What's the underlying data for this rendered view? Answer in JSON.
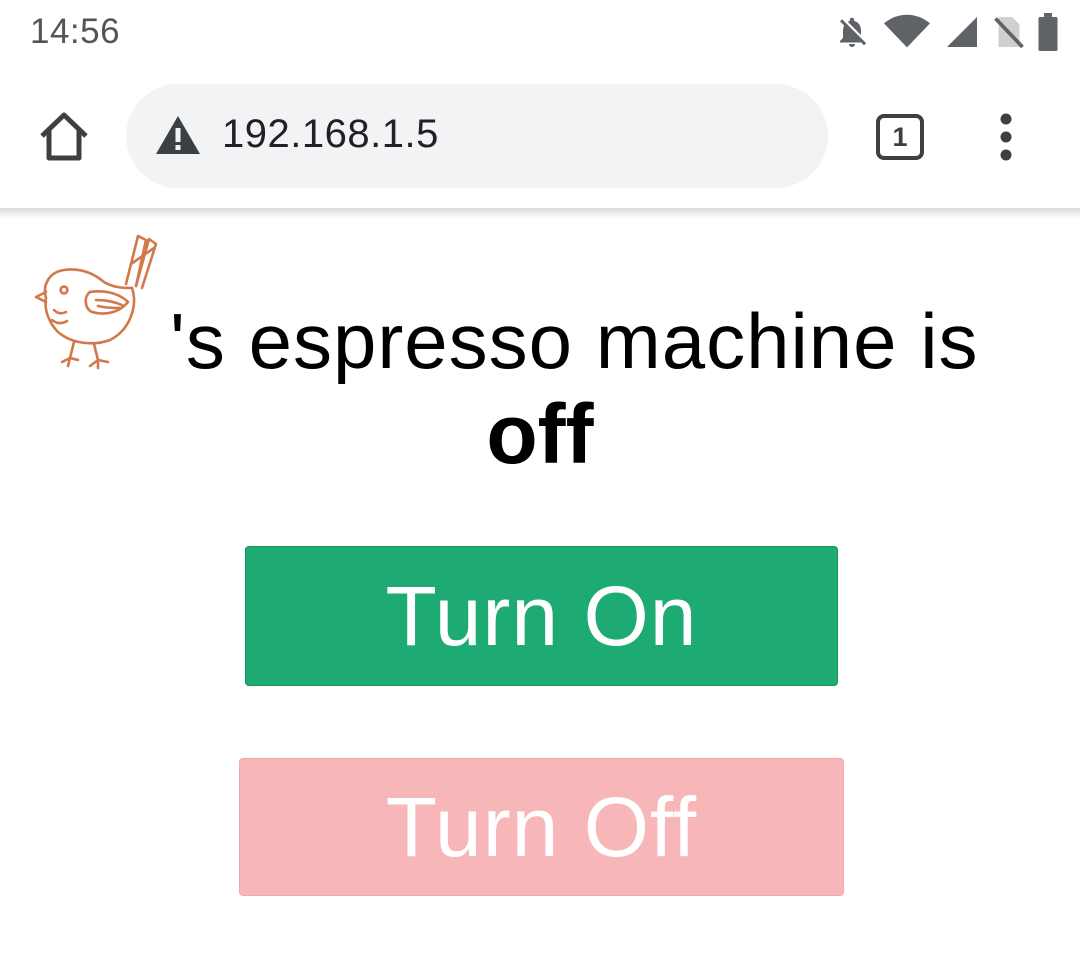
{
  "status_bar": {
    "time": "14:56",
    "icons": [
      "notifications-off-icon",
      "wifi-icon",
      "cell-signal-icon",
      "no-sim-icon",
      "battery-icon"
    ]
  },
  "browser": {
    "url": "192.168.1.5",
    "security_icon": "warning-icon",
    "tab_count": "1",
    "home_icon": "home-icon",
    "menu_icon": "more-vert-icon"
  },
  "page": {
    "headline": "'s espresso machine is",
    "state": "off",
    "turn_on_label": "Turn On",
    "turn_off_label": "Turn Off",
    "logo_icon": "bird-logo"
  },
  "colors": {
    "on_button": "#1eaa73",
    "off_button": "#f7b6b8",
    "logo": "#d2784a"
  }
}
